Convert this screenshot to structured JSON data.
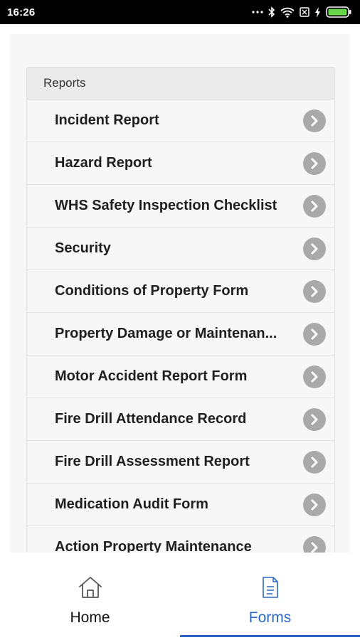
{
  "status_bar": {
    "time": "16:26",
    "icons": [
      "more-dots-icon",
      "bluetooth-icon",
      "wifi-icon",
      "sim-icon",
      "charging-icon",
      "battery-icon"
    ]
  },
  "reports": {
    "header": "Reports",
    "items": [
      {
        "label": "Incident Report"
      },
      {
        "label": "Hazard Report"
      },
      {
        "label": "WHS Safety Inspection Checklist"
      },
      {
        "label": "Security"
      },
      {
        "label": "Conditions of Property Form"
      },
      {
        "label": "Property Damage or Maintenan..."
      },
      {
        "label": "Motor Accident Report Form"
      },
      {
        "label": "Fire Drill Attendance Record"
      },
      {
        "label": "Fire Drill Assessment Report"
      },
      {
        "label": "Medication Audit Form"
      },
      {
        "label": "Action Property Maintenance"
      }
    ]
  },
  "tabs": {
    "home_label": "Home",
    "forms_label": "Forms",
    "active": "forms",
    "active_color": "#2a67c4"
  }
}
